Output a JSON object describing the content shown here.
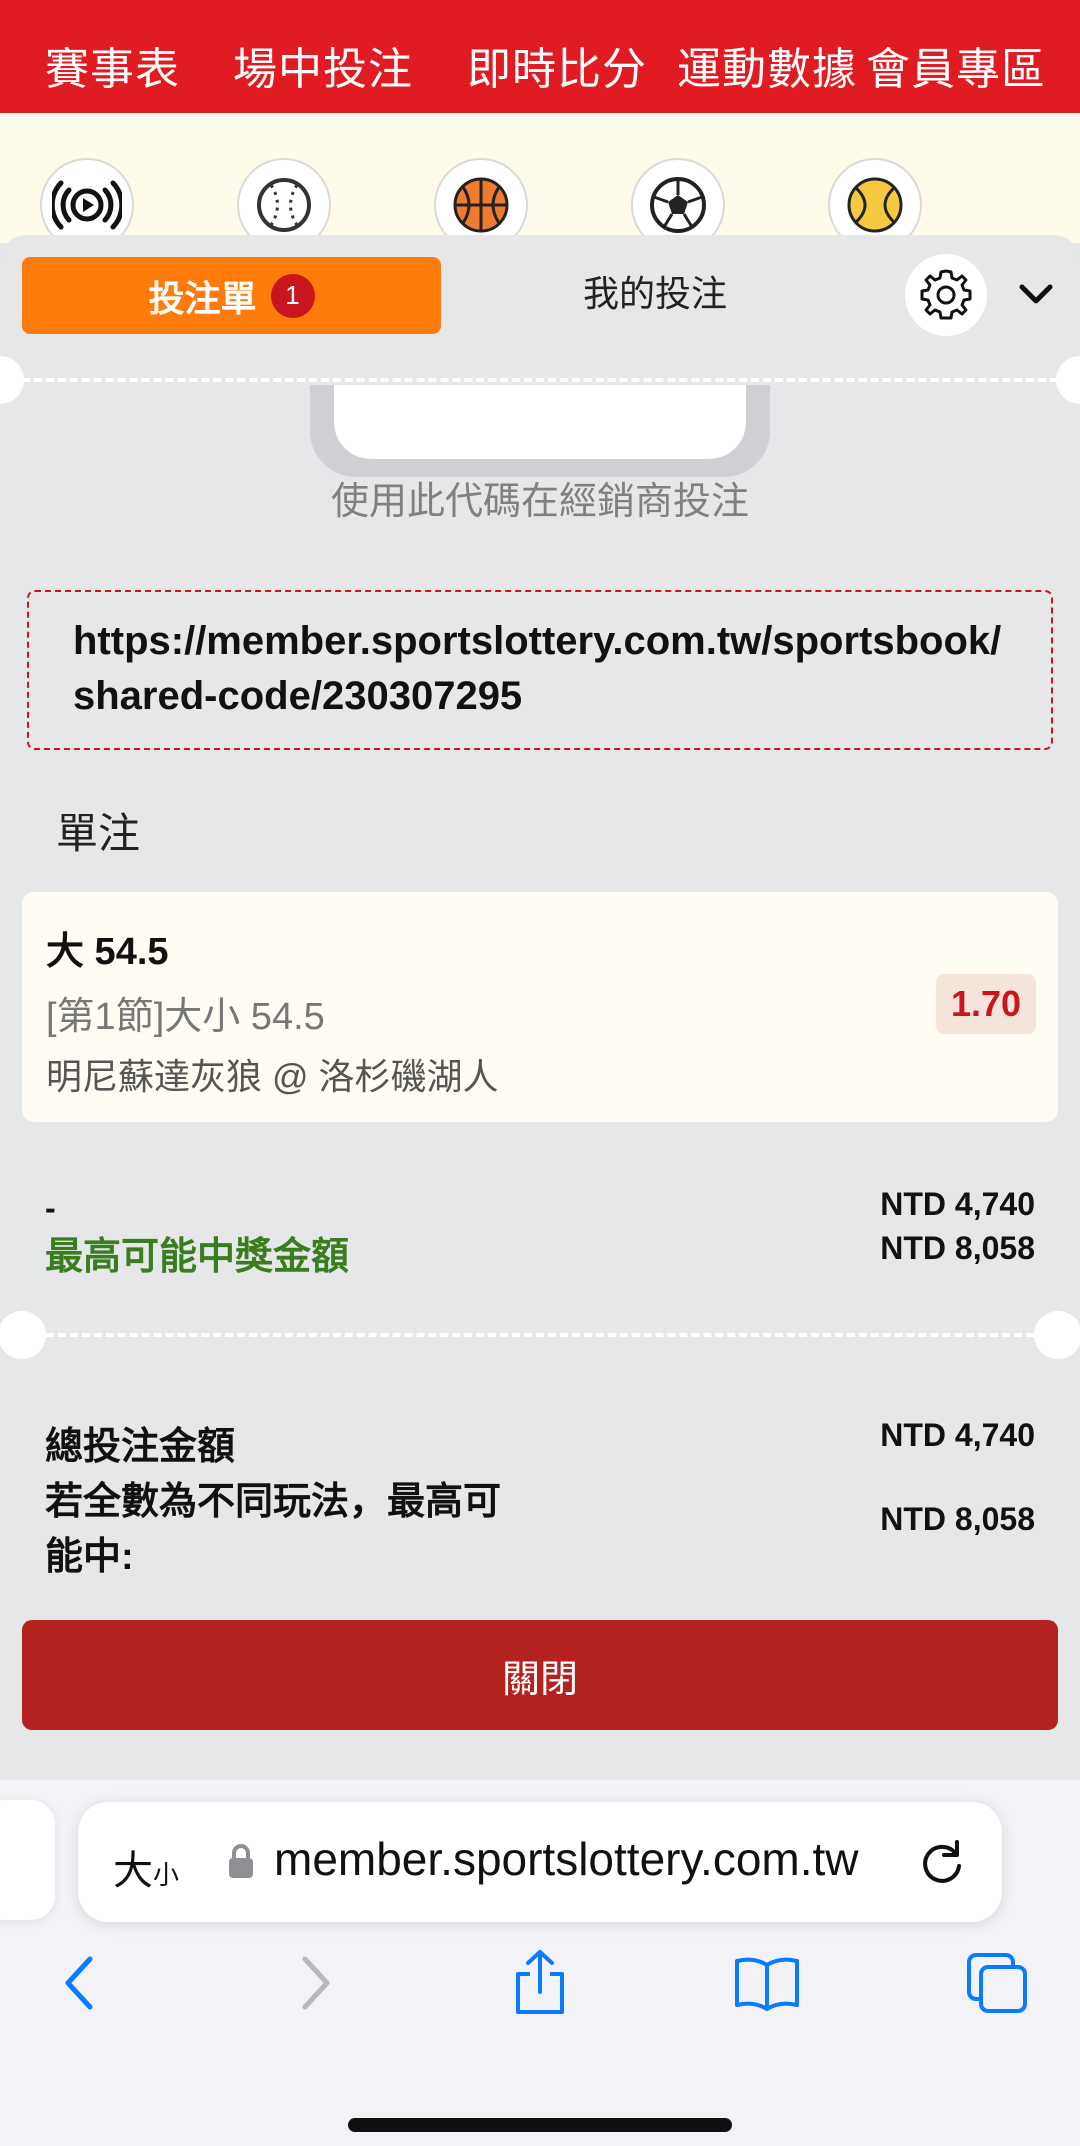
{
  "topnav": {
    "items": [
      "賽事表",
      "場中投注",
      "即時比分",
      "運動數據",
      "會員專區"
    ]
  },
  "sports": [
    "live-icon",
    "baseball-icon",
    "basketball-icon",
    "soccer-icon",
    "tennis-icon"
  ],
  "betslip": {
    "tab_active": "投注單",
    "badge_count": "1",
    "tab_other": "我的投注",
    "code_hint": "使用此代碼在經銷商投注",
    "share_url": "https://member.sportslottery.com.tw/sportsbook/shared-code/230307295",
    "section_title": "單注",
    "bet": {
      "selection": "大 54.5",
      "market": "[第1節]大小 54.5",
      "match": "明尼蘇達灰狼 @ 洛杉磯湖人",
      "odds": "1.70"
    },
    "stake_dash": "-",
    "max_win_label": "最高可能中獎金額",
    "stake_amount": "NTD 4,740",
    "max_win_amount": "NTD 8,058",
    "total_label": "總投注金額",
    "total_amount": "NTD 4,740",
    "combo_label_1": "若全數為不同玩法，最高可",
    "combo_label_2": "能中:",
    "combo_amount": "NTD 8,058",
    "close_label": "關閉"
  },
  "browser": {
    "aa_big": "大",
    "aa_small": "小",
    "address": "member.sportslottery.com.tw"
  },
  "colors": {
    "brand_red": "#e01b22",
    "accent_orange": "#ff7b0c",
    "close_button": "#b3221f",
    "win_green": "#3a7d20",
    "ios_blue": "#0a7aff"
  }
}
